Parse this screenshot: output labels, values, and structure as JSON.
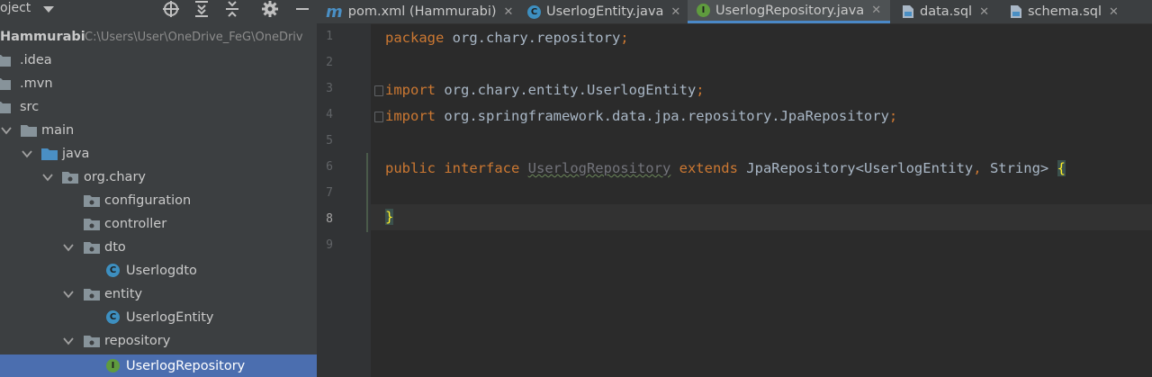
{
  "project_panel": {
    "toolbar_title": "oject",
    "icons": [
      "dropdown-icon",
      "locate-icon",
      "expand-all-icon",
      "collapse-all-icon",
      "gear-icon",
      "minimize-icon"
    ],
    "tree": [
      {
        "label": "Hammurabi",
        "path": "C:\\Users\\User\\OneDrive_FeG\\OneDriv",
        "type": "module"
      },
      {
        "label": ".idea",
        "type": "folder"
      },
      {
        "label": ".mvn",
        "type": "folder"
      },
      {
        "label": "src",
        "type": "folder"
      },
      {
        "label": "main",
        "type": "folder"
      },
      {
        "label": "java",
        "type": "source-folder"
      },
      {
        "label": "org.chary",
        "type": "package"
      },
      {
        "label": "configuration",
        "type": "package"
      },
      {
        "label": "controller",
        "type": "package"
      },
      {
        "label": "dto",
        "type": "package"
      },
      {
        "label": "Userlogdto",
        "type": "class"
      },
      {
        "label": "entity",
        "type": "package"
      },
      {
        "label": "UserlogEntity",
        "type": "class"
      },
      {
        "label": "repository",
        "type": "package"
      },
      {
        "label": "UserlogRepository",
        "type": "interface",
        "selected": true
      }
    ]
  },
  "tabs": [
    {
      "label": "pom.xml (Hammurabi)",
      "icon": "maven-icon",
      "icon_text": "m"
    },
    {
      "label": "UserlogEntity.java",
      "icon": "class-icon",
      "icon_text": "C"
    },
    {
      "label": "UserlogRepository.java",
      "icon": "interface-icon",
      "icon_text": "I",
      "active": true
    },
    {
      "label": "data.sql",
      "icon": "sql-file-icon"
    },
    {
      "label": "schema.sql",
      "icon": "sql-file-icon"
    }
  ],
  "editor": {
    "current_line": 8,
    "line_numbers": [
      "1",
      "2",
      "3",
      "4",
      "5",
      "6",
      "7",
      "8",
      "9"
    ],
    "code": {
      "l1_kw": "package",
      "l1_rest": " org.chary.repository",
      "l1_semi": ";",
      "l3_kw": "import",
      "l3_rest": " org.chary.entity.UserlogEntity",
      "l3_semi": ";",
      "l4_kw": "import",
      "l4_rest": " org.springframework.data.jpa.repository.JpaRepository",
      "l4_semi": ";",
      "l6_kw1": "public",
      "l6_kw2": " interface ",
      "l6_name": "UserlogRepository",
      "l6_kw3": " extends ",
      "l6_rest1": "JpaRepository<UserlogEntity",
      "l6_comma": ",",
      "l6_rest2": " String> ",
      "l6_brace": "{",
      "l8_brace": "}"
    }
  },
  "colors": {
    "keyword": "#cc7832",
    "text": "#a9b7c6",
    "selection": "#4b6eaf",
    "panel_bg": "#3c3f41",
    "editor_bg": "#2b2b2b"
  }
}
